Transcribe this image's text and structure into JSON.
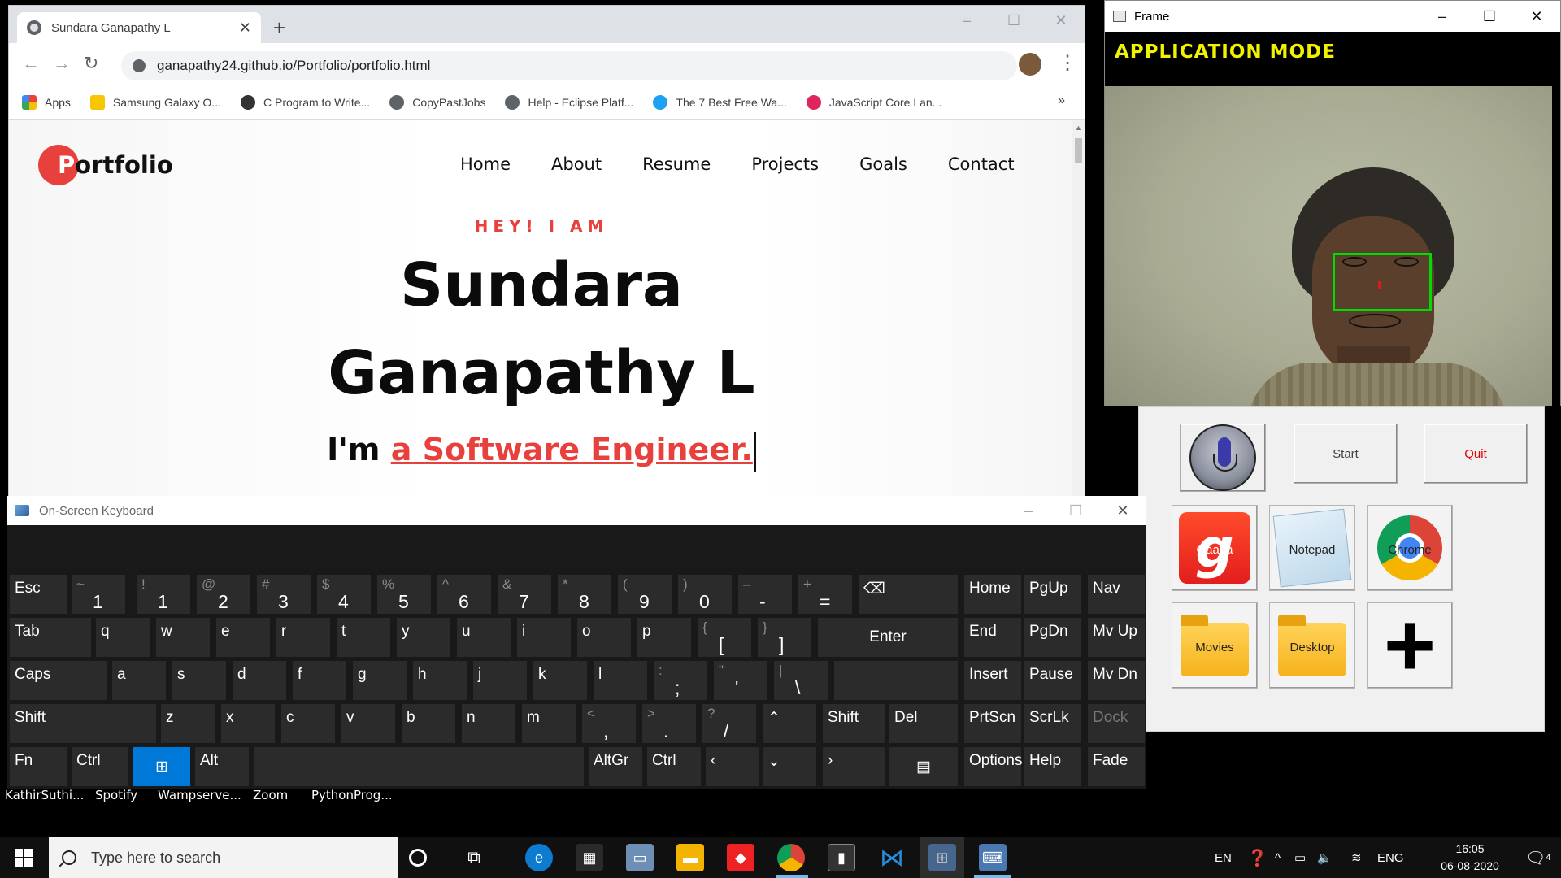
{
  "chrome": {
    "tab_title": "Sundara Ganapathy L",
    "url": "ganapathy24.github.io/Portfolio/portfolio.html",
    "bookmarks": [
      {
        "label": "Apps",
        "icon": "apps-grid-icon",
        "color": "#4285f4"
      },
      {
        "label": "Samsung Galaxy O...",
        "icon": "flipkart-icon",
        "color": "#f7c600"
      },
      {
        "label": "C Program to Write...",
        "icon": "site-icon",
        "color": "#333333"
      },
      {
        "label": "CopyPastJobs",
        "icon": "globe-icon",
        "color": "#5f6368"
      },
      {
        "label": "Help - Eclipse Platf...",
        "icon": "globe-icon",
        "color": "#5f6368"
      },
      {
        "label": "The 7 Best Free Wa...",
        "icon": "site-icon",
        "color": "#1da1f2"
      },
      {
        "label": "JavaScript Core Lan...",
        "icon": "site-icon",
        "color": "#e0245e"
      }
    ],
    "bookmarks_more": "»"
  },
  "portfolio": {
    "logo_first": "P",
    "logo_rest": "ortfolio",
    "nav": [
      "Home",
      "About",
      "Resume",
      "Projects",
      "Goals",
      "Contact"
    ],
    "kicker": "HEY! I AM",
    "name_line1": "Sundara",
    "name_line2": "Ganapathy L",
    "role_prefix": "I'm ",
    "role_typed": "a Software Engineer."
  },
  "frame": {
    "title": "Frame",
    "mode": "APPLICATION MODE"
  },
  "panel": {
    "start": "Start",
    "quit": "Quit",
    "tiles": [
      {
        "label": "Gaana",
        "icon": "gaana-icon"
      },
      {
        "label": "Notepad",
        "icon": "notepad-icon"
      },
      {
        "label": "Chrome",
        "icon": "chrome-icon"
      },
      {
        "label": "Movies",
        "icon": "folder-icon"
      },
      {
        "label": "Desktop",
        "icon": "folder-icon"
      },
      {
        "label": "",
        "icon": "plus-icon"
      }
    ]
  },
  "osk": {
    "title": "On-Screen Keyboard"
  },
  "desktop_labels": [
    "KathirSuthi...",
    "Spotify",
    "Wampserve...",
    "Zoom",
    "PythonProg..."
  ],
  "taskbar": {
    "search_placeholder": "Type here to search",
    "lang": "EN",
    "lang2": "ENG",
    "time": "16:05",
    "date": "06-08-2020",
    "notif_count": "4"
  },
  "colors": {
    "accent_red": "#e8403c",
    "mode_yellow": "#f2f200",
    "face_box_green": "#00dd00",
    "osk_key": "#2b2b2b",
    "osk_win_key": "#0078d7"
  }
}
